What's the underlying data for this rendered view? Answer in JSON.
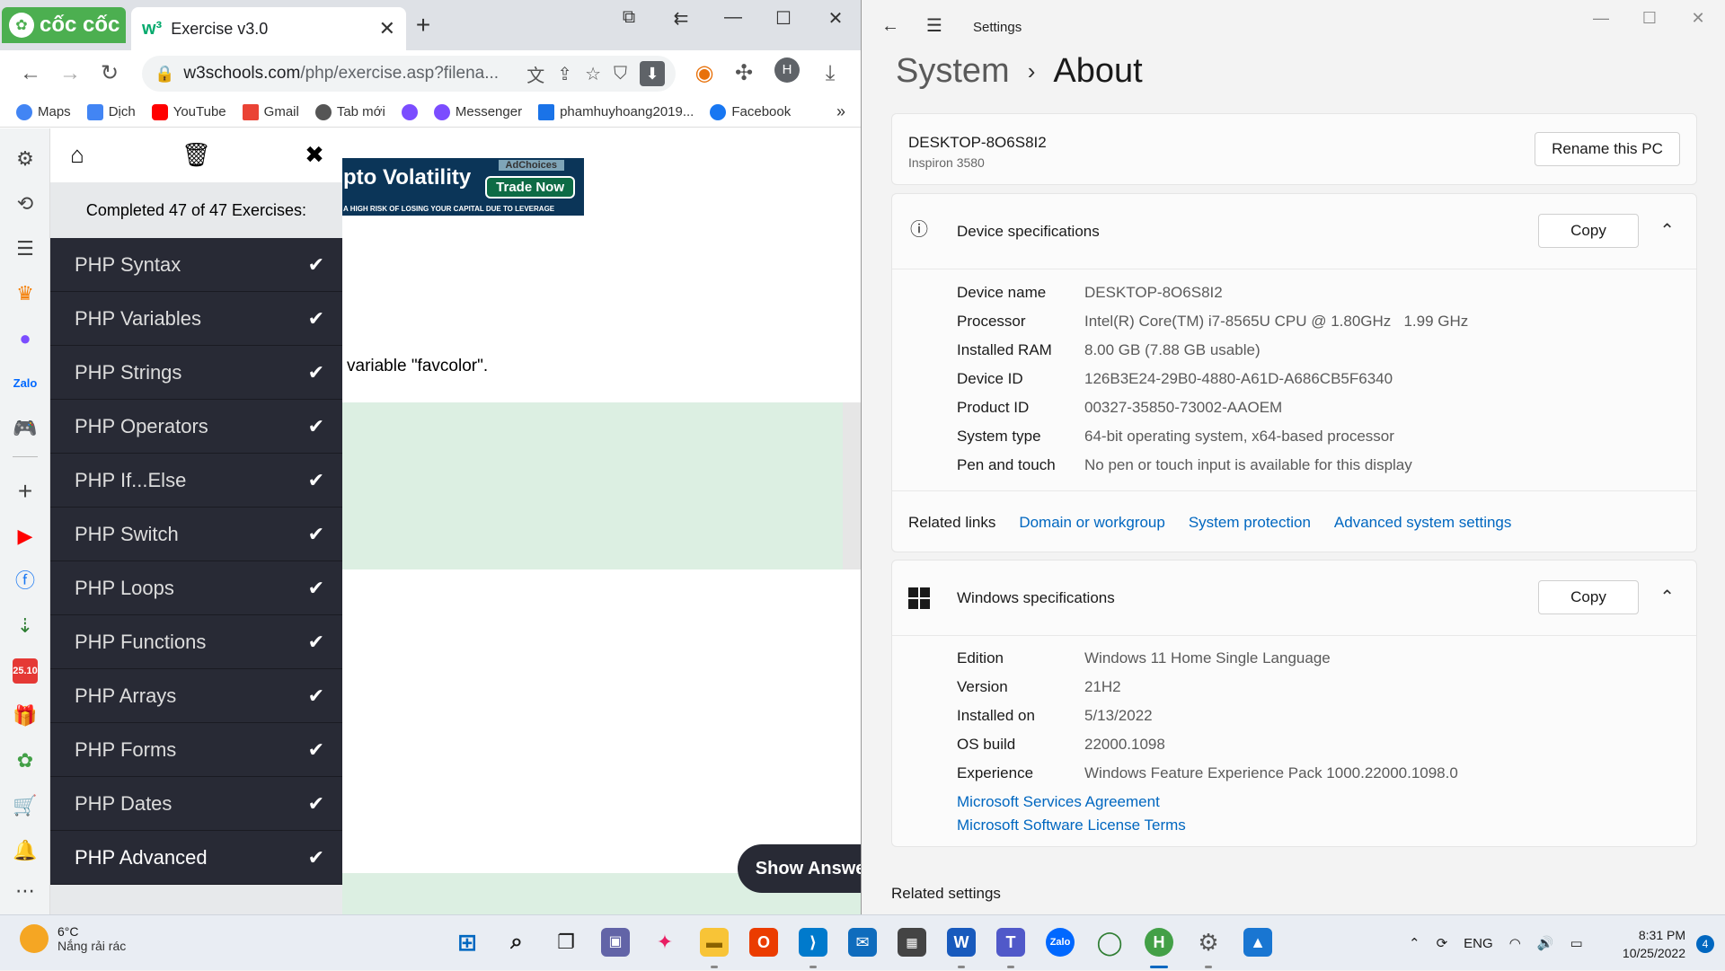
{
  "browser": {
    "brand": "cốc cốc",
    "tab_title": "Exercise v3.0",
    "tab_close": "✕",
    "new_tab": "+",
    "url_host": "w3schools.com",
    "url_path": "/php/exercise.asp?filena...",
    "avatar_letter": "H",
    "bookmarks": [
      {
        "label": "Maps",
        "color": "#4285f4"
      },
      {
        "label": "Dịch",
        "color": "#4285f4"
      },
      {
        "label": "YouTube",
        "color": "#ff0000"
      },
      {
        "label": "Gmail",
        "color": "#ea4335"
      },
      {
        "label": "Tab mới",
        "color": "#555555"
      },
      {
        "label": "",
        "color": "#7b4dff"
      },
      {
        "label": "Messenger",
        "color": "#7b4dff"
      },
      {
        "label": "phamhuyhoang2019...",
        "color": "#1a73e8"
      },
      {
        "label": "Facebook",
        "color": "#1877f2"
      }
    ],
    "bookmarks_more": "»"
  },
  "exercise": {
    "progress": "Completed 47 of 47 Exercises:",
    "items": [
      {
        "label": "PHP Syntax"
      },
      {
        "label": "PHP Variables"
      },
      {
        "label": "PHP Strings"
      },
      {
        "label": "PHP Operators"
      },
      {
        "label": "PHP If...Else"
      },
      {
        "label": "PHP Switch"
      },
      {
        "label": "PHP Loops"
      },
      {
        "label": "PHP Functions"
      },
      {
        "label": "PHP Arrays"
      },
      {
        "label": "PHP Forms"
      },
      {
        "label": "PHP Dates"
      },
      {
        "label": "PHP Advanced"
      }
    ],
    "task_text": "variable \"favcolor\".",
    "show_answer": "Show Answer",
    "ad": {
      "headline": "pto Volatility",
      "button": "Trade Now",
      "choices": "AdChoices",
      "disclaimer": "A HIGH RISK OF LOSING YOUR CAPITAL DUE TO LEVERAGE"
    }
  },
  "settings": {
    "window_title": "Settings",
    "breadcrumb_parent": "System",
    "breadcrumb_current": "About",
    "pc_name": "DESKTOP-8O6S8I2",
    "pc_model": "Inspiron 3580",
    "rename_button": "Rename this PC",
    "device_specs_title": "Device specifications",
    "copy_label": "Copy",
    "device_specs": [
      {
        "k": "Device name",
        "v": "DESKTOP-8O6S8I2"
      },
      {
        "k": "Processor",
        "v": "Intel(R) Core(TM) i7-8565U CPU @ 1.80GHz   1.99 GHz"
      },
      {
        "k": "Installed RAM",
        "v": "8.00 GB (7.88 GB usable)"
      },
      {
        "k": "Device ID",
        "v": "126B3E24-29B0-4880-A61D-A686CB5F6340"
      },
      {
        "k": "Product ID",
        "v": "00327-35850-73002-AAOEM"
      },
      {
        "k": "System type",
        "v": "64-bit operating system, x64-based processor"
      },
      {
        "k": "Pen and touch",
        "v": "No pen or touch input is available for this display"
      }
    ],
    "related_links_label": "Related links",
    "related_links": [
      "Domain or workgroup",
      "System protection",
      "Advanced system settings"
    ],
    "windows_specs_title": "Windows specifications",
    "windows_specs": [
      {
        "k": "Edition",
        "v": "Windows 11 Home Single Language"
      },
      {
        "k": "Version",
        "v": "21H2"
      },
      {
        "k": "Installed on",
        "v": "5/13/2022"
      },
      {
        "k": "OS build",
        "v": "22000.1098"
      },
      {
        "k": "Experience",
        "v": "Windows Feature Experience Pack 1000.22000.1098.0"
      }
    ],
    "ms_links": [
      "Microsoft Services Agreement",
      "Microsoft Software License Terms"
    ],
    "related_settings": "Related settings"
  },
  "taskbar": {
    "temp": "6°C",
    "weather": "Nắng rải rác",
    "language": "ENG",
    "time": "8:31 PM",
    "date": "10/25/2022",
    "notifications": "4"
  }
}
